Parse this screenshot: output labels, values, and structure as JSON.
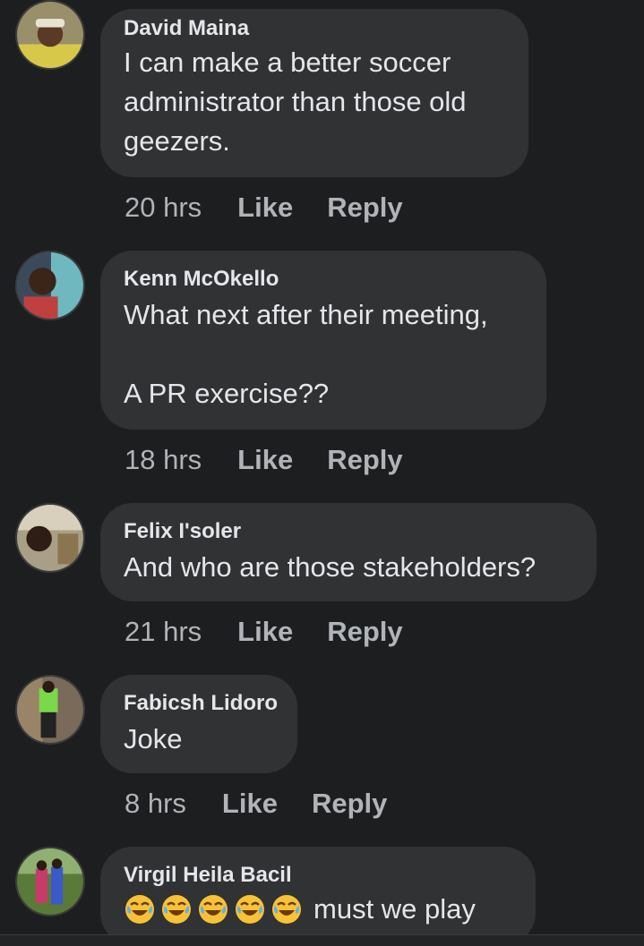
{
  "comments": [
    {
      "author": "David Maina",
      "text": "I can make a better soccer\nadministrator than those old\ngeezers.",
      "time": "20 hrs",
      "like": "Like",
      "reply": "Reply"
    },
    {
      "author": "Kenn McOkello",
      "text": "What next after their meeting,\n\nA PR exercise??",
      "time": "18 hrs",
      "like": "Like",
      "reply": "Reply"
    },
    {
      "author": "Felix I'soler",
      "text": "And who are those stakeholders?",
      "time": "21 hrs",
      "like": "Like",
      "reply": "Reply"
    },
    {
      "author": "Fabicsh Lidoro",
      "text": "Joke",
      "time": "8 hrs",
      "like": "Like",
      "reply": "Reply"
    },
    {
      "author": "Virgil Heila Bacil",
      "emojis": [
        "face-with-tears-of-joy-icon",
        "face-with-tears-of-joy-icon",
        "face-with-tears-of-joy-icon",
        "face-with-tears-of-joy-icon",
        "face-with-tears-of-joy-icon"
      ],
      "text": "must we play"
    }
  ],
  "colors": {
    "background": "#1c1e1f",
    "bubble": "#303233",
    "text": "#e4e6eb",
    "meta": "#b0b3b8"
  }
}
